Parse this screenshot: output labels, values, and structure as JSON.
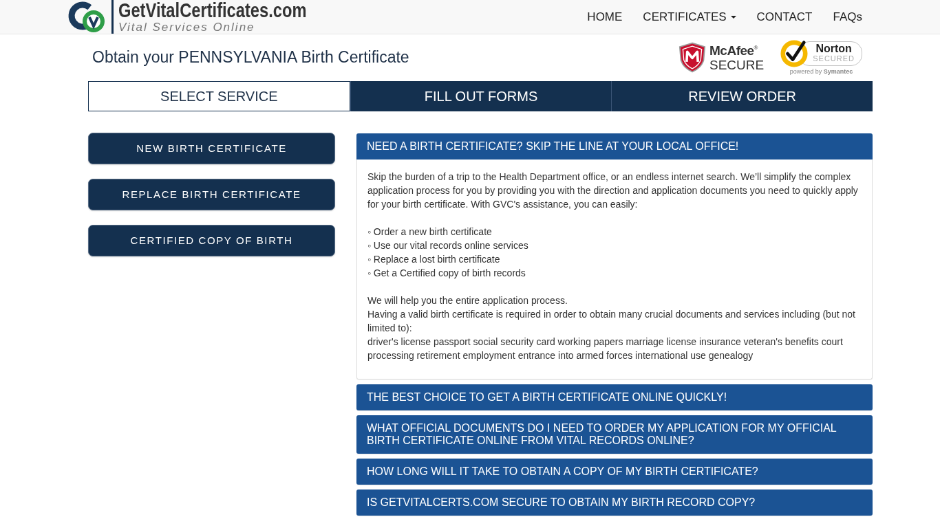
{
  "header": {
    "logo": {
      "title": "GetVitalCertificates.com",
      "tagline": "Vital Services Online"
    },
    "nav": [
      {
        "label": "HOME",
        "dropdown": false
      },
      {
        "label": "CERTIFICATES",
        "dropdown": true
      },
      {
        "label": "CONTACT",
        "dropdown": false
      },
      {
        "label": "FAQs",
        "dropdown": false
      }
    ]
  },
  "page_title": "Obtain your PENNSYLVANIA Birth Certificate",
  "trust_badges": [
    {
      "kind": "mcafee",
      "name": "McAfee$^{®}$",
      "label": "SECURE"
    },
    {
      "kind": "norton",
      "name": "Norton",
      "label": "SECURED",
      "caption": "powered by **Symantec**"
    }
  ],
  "steps": [
    {
      "label": "SELECT SERVICE",
      "selected": true
    },
    {
      "label": "FILL OUT FORMS",
      "selected": false
    },
    {
      "label": "REVIEW ORDER",
      "selected": false
    }
  ],
  "services": [
    "NEW BIRTH CERTIFICATE",
    "REPLACE BIRTH CERTIFICATE",
    "CERTIFIED COPY OF BIRTH"
  ],
  "faq": [
    {
      "title": "NEED A BIRTH CERTIFICATE? SKIP THE LINE AT YOUR LOCAL OFFICE!",
      "expanded": true,
      "body": [
        [
          "Skip the burden of a trip to the Health Department office, or an endless internet search. We’ll simplify the complex application process for you by providing you with the direction and application documents you need to quickly apply for your birth certificate. With GVC's assistance, you can easily:"
        ],
        [
          "◦ Order a new birth certificate",
          "◦ Use our vital records online services",
          "◦ Replace a lost birth certificate",
          "◦ Get a Certified copy of birth records"
        ],
        [
          "We will help you the entire application process.",
          "Having a valid birth certificate is required in order to obtain many crucial documents and services including (but not limited to):",
          "driver's license passport social security card working papers marriage license insurance veteran's benefits court processing retirement employment entrance into armed forces international use genealogy"
        ]
      ]
    },
    {
      "title": "THE BEST CHOICE TO GET A BIRTH CERTIFICATE ONLINE QUICKLY!",
      "expanded": false
    },
    {
      "title": "WHAT OFFICIAL DOCUMENTS DO I NEED TO ORDER MY APPLICATION FOR MY OFFICIAL BIRTH CERTIFICATE ONLINE FROM VITAL RECORDS ONLINE?",
      "expanded": false
    },
    {
      "title": "HOW LONG WILL IT TAKE TO OBTAIN A COPY OF MY BIRTH CERTIFICATE?",
      "expanded": false
    },
    {
      "title": "IS GETVITALCERTS.COM SECURE TO OBTAIN MY BIRTH RECORD COPY?",
      "expanded": false
    }
  ]
}
